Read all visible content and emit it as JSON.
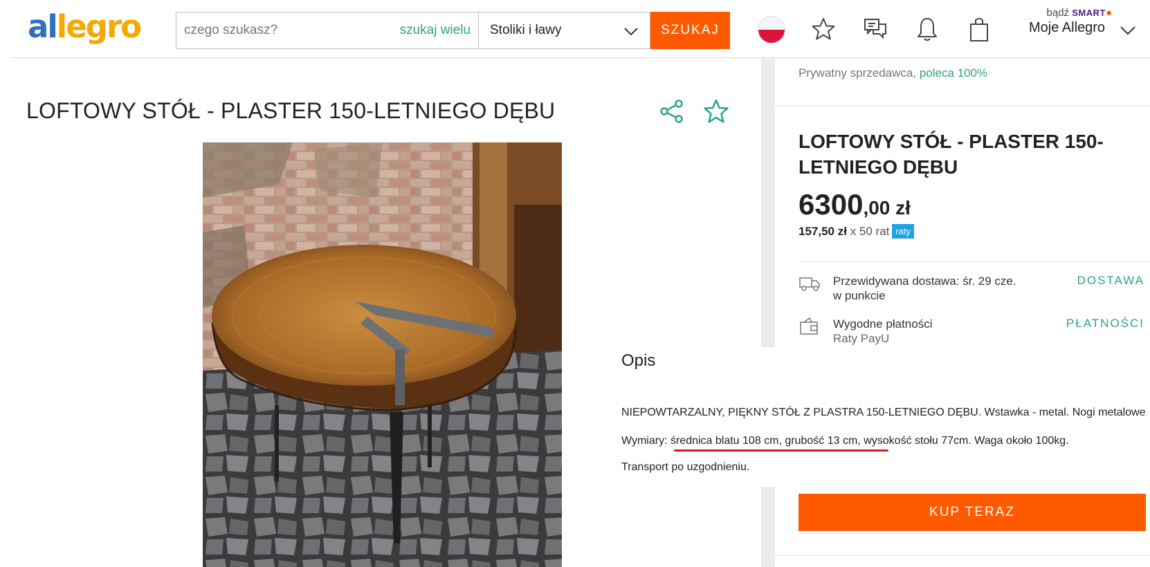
{
  "header": {
    "logo": {
      "part1": "al",
      "part2": "legro"
    },
    "search": {
      "placeholder": "czego szukasz?",
      "multi_link": "szukaj wielu"
    },
    "category": "Stoliki i ławy",
    "search_button": "SZUKAJ",
    "account": {
      "prefix": "bądź",
      "smart": "SMART",
      "label": "Moje Allegro"
    }
  },
  "product": {
    "title": "LOFTOWY STÓŁ - PLASTER 150-LETNIEGO DĘBU"
  },
  "sidebar": {
    "seller_prefix": "Prywatny sprzedawca,",
    "seller_recommend": "poleca 100%",
    "title": "LOFTOWY STÓŁ - PLASTER 150-LETNIEGO DĘBU",
    "price_main": "6300",
    "price_cents": ",00 zł",
    "installment_amount": "157,50 zł",
    "installment_count": "x 50 rat",
    "installment_badge": "raty",
    "delivery": {
      "line1": "Przewidywana dostawa: śr. 29 cze.",
      "line2": "w punkcie",
      "link": "DOSTAWA"
    },
    "payments": {
      "line1": "Wygodne płatności",
      "line2": "Raty PayU",
      "link": "PŁATNOŚCI"
    },
    "buy_button": "KUP TERAZ"
  },
  "description": {
    "heading": "Opis",
    "p1": "NIEPOWTARZALNY, PIĘKNY STÓŁ Z PLASTRA 150-LETNIEGO DĘBU. Wstawka - metal. Nogi metalowe",
    "p2": "Wymiary: średnica blatu 108 cm,  grubość 13 cm, wysokość stołu 77cm. Waga około 100kg.",
    "p3": "Transport po uzgodnieniu."
  },
  "colors": {
    "accent": "#ff5a00",
    "teal": "#2ea28b",
    "badge": "#1fa1e6",
    "underline": "#e0121e"
  },
  "icons": [
    "flag-pl-icon",
    "star-icon",
    "chat-icon",
    "bell-icon",
    "bag-icon",
    "chevron-down-icon",
    "share-icon",
    "truck-icon",
    "wallet-icon"
  ]
}
